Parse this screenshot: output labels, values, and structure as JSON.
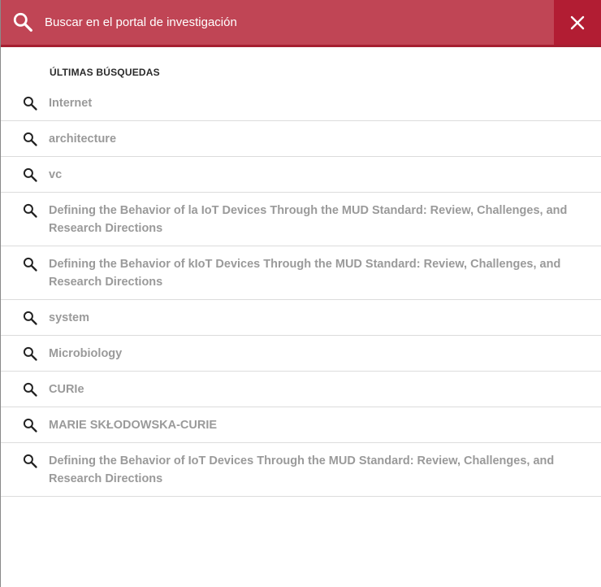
{
  "search": {
    "placeholder": "Buscar en el portal de investigación"
  },
  "recent": {
    "title": "ÚLTIMAS BÚSQUEDAS",
    "items": [
      "Internet",
      "architecture",
      "vc",
      "Defining the Behavior of la IoT Devices Through the MUD Standard: Review, Challenges, and Research Directions",
      "Defining the Behavior of kIoT Devices Through the MUD Standard: Review, Challenges, and Research Directions",
      "system",
      "Microbiology",
      "CURIe",
      "MARIE SKŁODOWSKA-CURIE",
      "Defining the Behavior of IoT Devices Through the MUD Standard: Review, Challenges, and Research Directions"
    ]
  },
  "icons": {
    "search": "search-icon",
    "close": "close-icon",
    "history_item": "search-icon"
  },
  "colors": {
    "search_bar": "#c04555",
    "close_button": "#b21d33",
    "accent_border": "#a51e30",
    "item_text": "#9a9a9a"
  }
}
